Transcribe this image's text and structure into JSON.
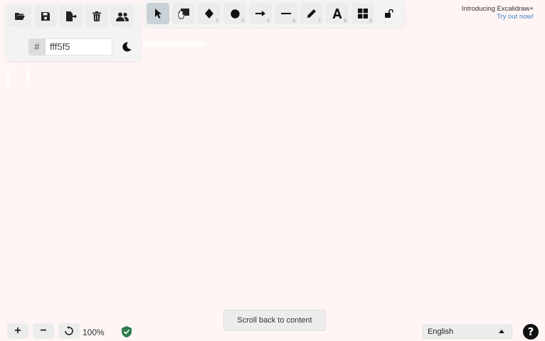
{
  "canvas": {
    "background": "#fff5f5"
  },
  "file_toolbar": {
    "buttons": [
      {
        "name": "open",
        "icon": "folder-open-icon"
      },
      {
        "name": "save",
        "icon": "save-icon"
      },
      {
        "name": "export",
        "icon": "export-icon"
      },
      {
        "name": "clear-canvas",
        "icon": "trash-icon"
      },
      {
        "name": "collaborate",
        "icon": "users-icon"
      }
    ],
    "color_prefix": "#",
    "background_color_value": "fff5f5",
    "theme_toggle_icon": "moon-icon"
  },
  "shape_toolbar": {
    "tools": [
      {
        "name": "selection",
        "icon": "pointer-icon",
        "shortcut": "",
        "active": true
      },
      {
        "name": "hand",
        "icon": "hand-icon",
        "shortcut": "",
        "active": false
      },
      {
        "name": "diamond",
        "icon": "diamond-icon",
        "shortcut": "3",
        "active": false
      },
      {
        "name": "ellipse",
        "icon": "circle-icon",
        "shortcut": "4",
        "active": false
      },
      {
        "name": "arrow",
        "icon": "arrow-icon",
        "shortcut": "5",
        "active": false
      },
      {
        "name": "line",
        "icon": "line-icon",
        "shortcut": "6",
        "active": false
      },
      {
        "name": "draw",
        "icon": "pencil-icon",
        "shortcut": "7",
        "active": false
      },
      {
        "name": "text",
        "icon": "text-icon",
        "shortcut": "8",
        "active": false
      },
      {
        "name": "library",
        "icon": "grid-icon",
        "shortcut": "9",
        "active": false
      },
      {
        "name": "lock",
        "icon": "lock-icon",
        "shortcut": "",
        "active": false
      }
    ]
  },
  "promo": {
    "line1": "Introducing Excalidraw+",
    "line2": "Try out now!"
  },
  "scroll_back": {
    "label": "Scroll back to content"
  },
  "zoom": {
    "zoom_in_label": "+",
    "zoom_out_label": "−",
    "reset_icon": "reset-icon",
    "level": "100%",
    "shield_icon": "shield-check-icon"
  },
  "footer": {
    "language": "English",
    "help_label": "?"
  }
}
